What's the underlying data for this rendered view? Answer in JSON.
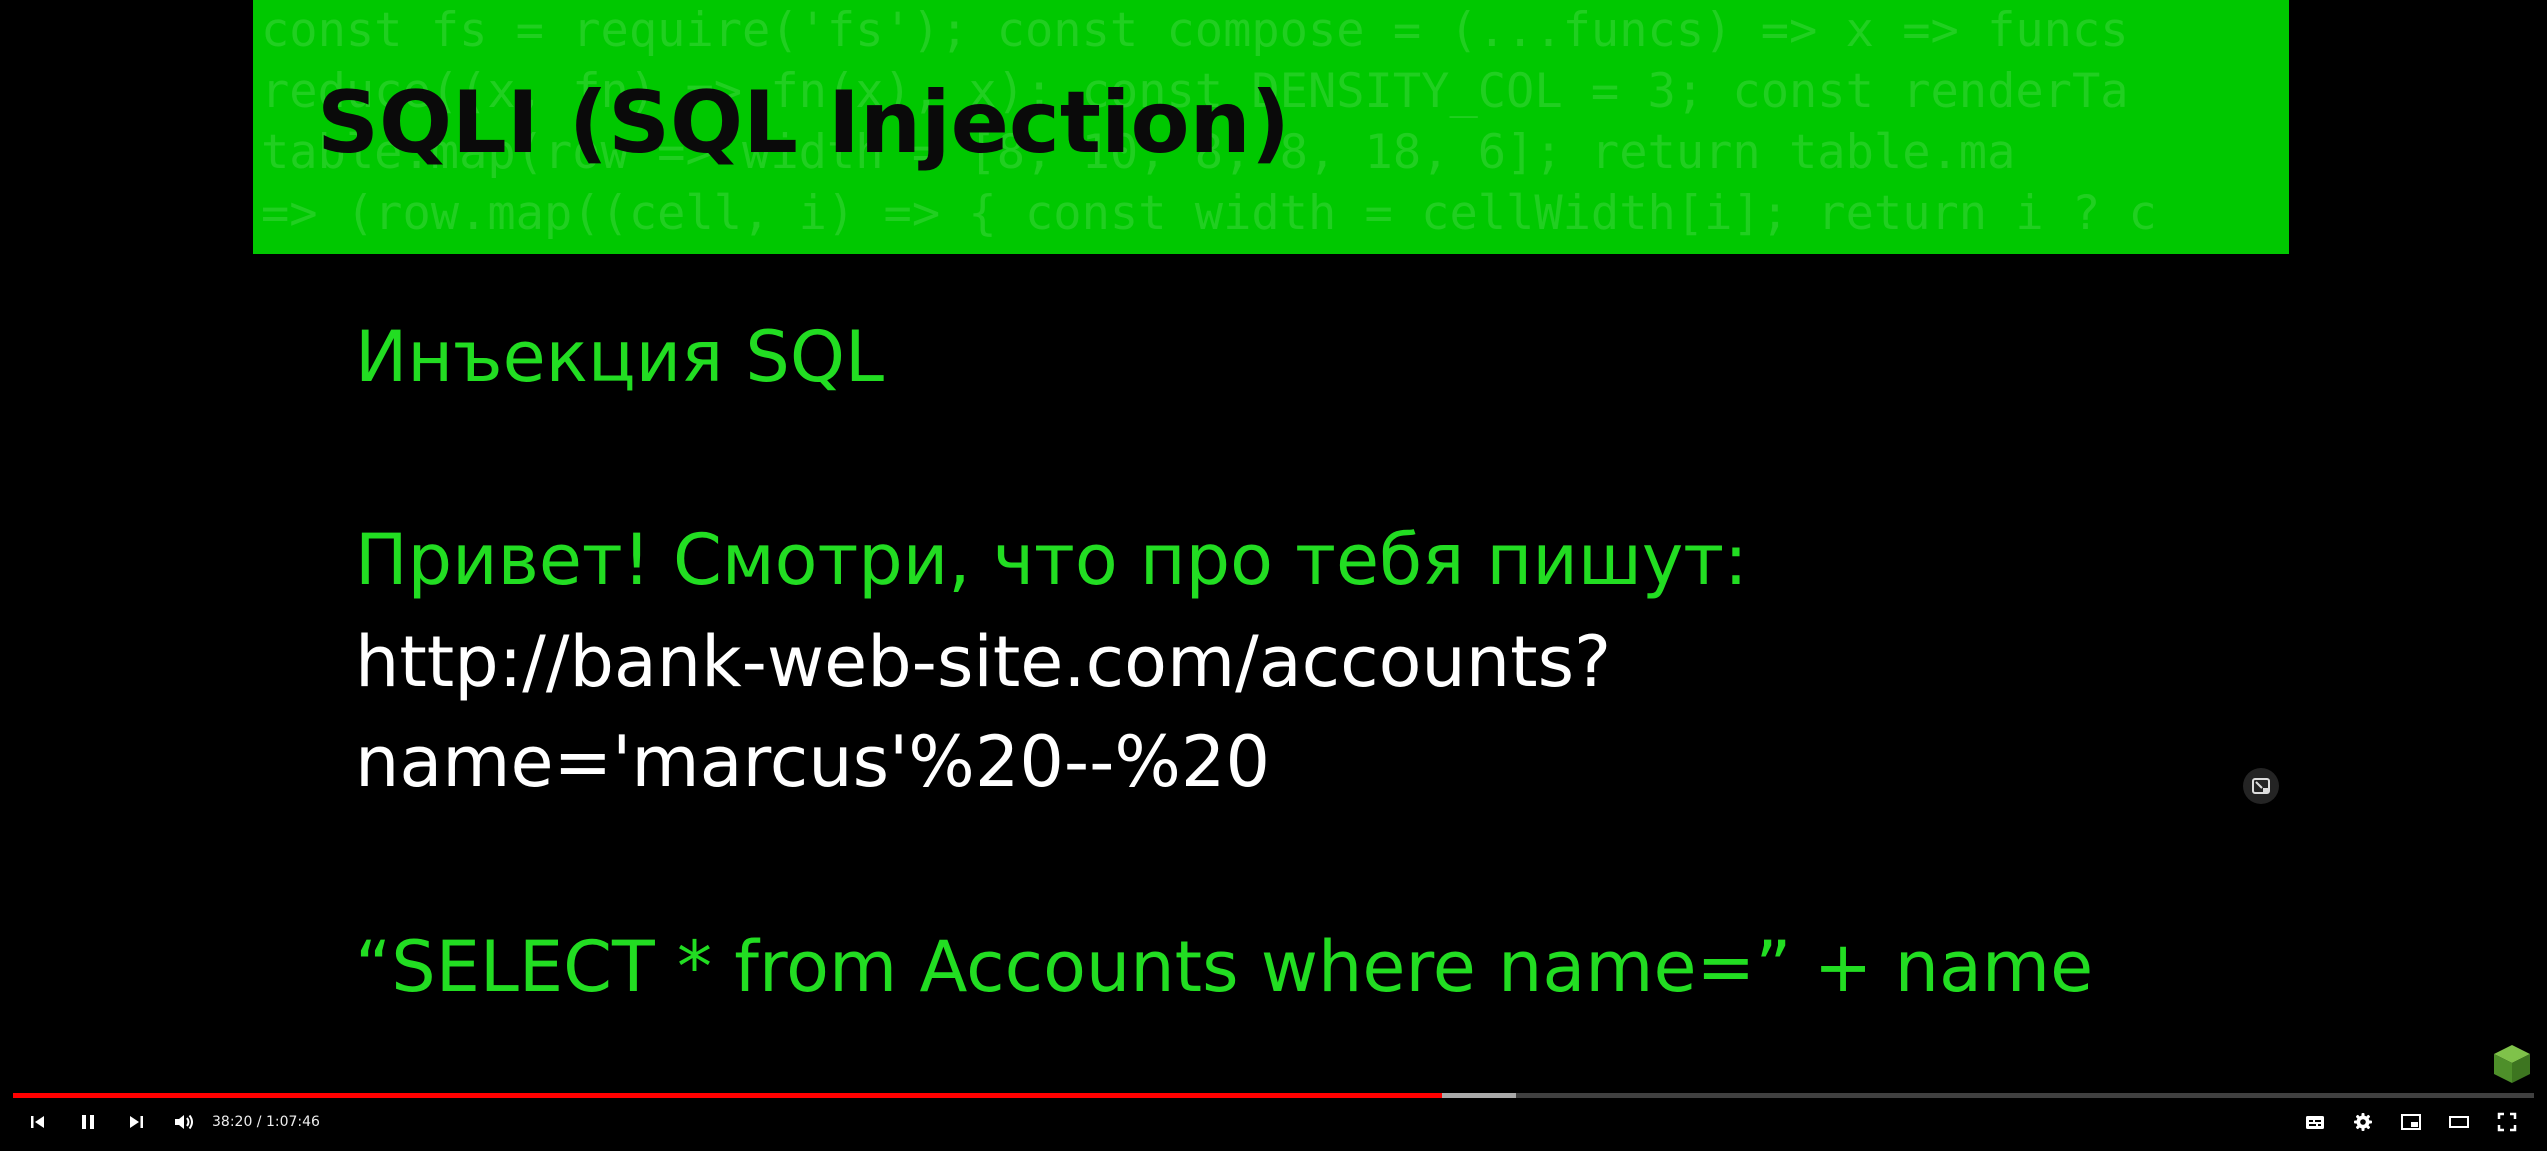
{
  "slide": {
    "code_background": [
      "const fs = require('fs'); const compose = (...funcs) => x => funcs",
      "reduce((x, fn) => fn(x), x); const DENSITY_COL = 3; const renderTa",
      "table.map(row => width = [8, 10, 8, 8, 18, 6]; return table.ma",
      "=> (row.map((cell, i) => { const width = cellWidth[i]; return i ? c"
    ],
    "title": "SQLI (SQL Injection)",
    "subtitle": "Инъекция SQL",
    "message": "Привет! Смотри, что про тебя пишут:",
    "url_line_1": "http://bank-web-site.com/accounts?",
    "url_line_2": "name='marcus'%20--%20",
    "query": "“SELECT * from Accounts where name=” + name"
  },
  "player": {
    "time_display": "38:20 / 1:07:46",
    "progress_played_fraction": 0.567,
    "progress_buffered_fraction": 0.596,
    "progress_color": "#ff0000",
    "icons": [
      "previous-icon",
      "pause-icon",
      "next-icon",
      "volume-icon",
      "subtitles-icon",
      "settings-gear-icon",
      "miniplayer-icon",
      "theater-mode-icon",
      "fullscreen-icon"
    ]
  },
  "colors": {
    "header_band": "#00c800",
    "slide_green_text": "#22dd22",
    "slide_white_text": "#ffffff",
    "background": "#000000"
  }
}
